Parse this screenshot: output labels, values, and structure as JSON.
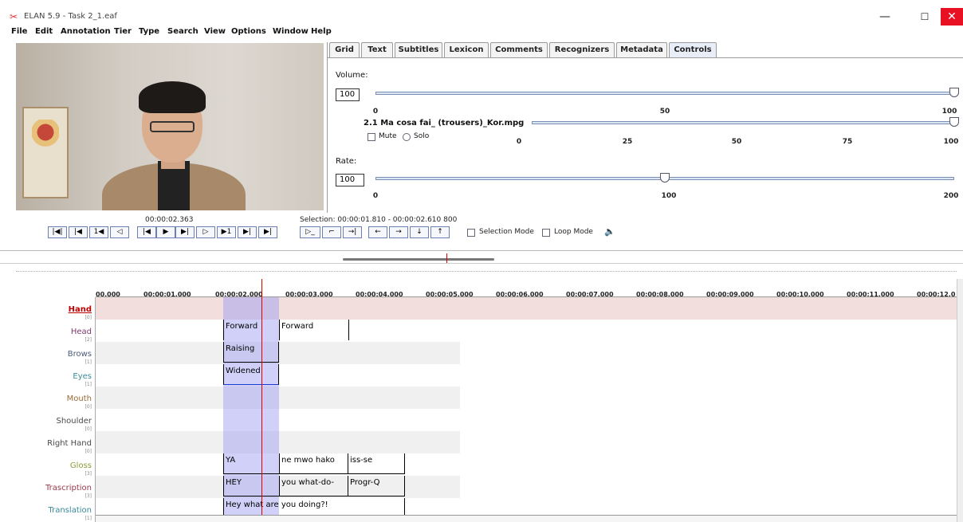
{
  "window": {
    "title": "ELAN 5.9 - Task 2_1.eaf",
    "logo": "elan-logo",
    "min": "—",
    "max": "☐",
    "close": "✕"
  },
  "menu": [
    "File",
    "Edit",
    "Annotation",
    "Tier",
    "Type",
    "Search",
    "View",
    "Options",
    "Window",
    "Help"
  ],
  "tabs": [
    "Grid",
    "Text",
    "Subtitles",
    "Lexicon",
    "Comments",
    "Recognizers",
    "Metadata",
    "Controls"
  ],
  "active_tab": "Controls",
  "controls": {
    "volume_label": "Volume:",
    "volume_value": "100",
    "volume_level": 100,
    "volume_ticks": [
      "0",
      "50",
      "100"
    ],
    "media_file": "2.1 Ma cosa fai_ (trousers)_Kor.mpg",
    "media_level": 100,
    "mute_label": "Mute",
    "solo_label": "Solo",
    "media_ticks": [
      "0",
      "25",
      "50",
      "75",
      "100"
    ],
    "rate_label": "Rate:",
    "rate_value": "100",
    "rate_level": 100,
    "rate_ticks": [
      "0",
      "100",
      "200"
    ]
  },
  "player": {
    "timecode": "00:00:02.363",
    "selection": "Selection: 00:00:01.810 - 00:00:02.610  800",
    "buttons": [
      "|◀|",
      "|◀",
      "1◀",
      "◁",
      "|◀",
      "▶",
      "▶|",
      "▷",
      "▶1",
      "▶|",
      "▶|"
    ],
    "sel_buttons": [
      "▷_",
      "⌐",
      "→|",
      "←",
      "→",
      "↓",
      "↑"
    ],
    "selection_mode_label": "Selection Mode",
    "loop_mode_label": "Loop Mode",
    "speaker_icon": "speaker-icon"
  },
  "ruler": [
    "00.000",
    "00:00:01.000",
    "00:00:02.000",
    "00:00:03.000",
    "00:00:04.000",
    "00:00:05.000",
    "00:00:06.000",
    "00:00:07.000",
    "00:00:08.000",
    "00:00:09.000",
    "00:00:10.000",
    "00:00:11.000",
    "00:00:12.0"
  ],
  "tiers": [
    {
      "name": "Hand",
      "count": "[0]",
      "color": "#c00000"
    },
    {
      "name": "Head",
      "count": "[2]",
      "color": "#7a3a6a"
    },
    {
      "name": "Brows",
      "count": "[1]",
      "color": "#4a5a7a"
    },
    {
      "name": "Eyes",
      "count": "[1]",
      "color": "#3a8a9a"
    },
    {
      "name": "Mouth",
      "count": "[0]",
      "color": "#9a6a3a"
    },
    {
      "name": "Shoulder",
      "count": "[0]",
      "color": "#4a4a4a"
    },
    {
      "name": "Right Hand",
      "count": "[0]",
      "color": "#4a4a4a"
    },
    {
      "name": "Gloss",
      "count": "[3]",
      "color": "#8a9a3a"
    },
    {
      "name": "Trascription",
      "count": "[3]",
      "color": "#9a3a4a"
    },
    {
      "name": "Translation",
      "count": "[1]",
      "color": "#3a8a9a"
    }
  ],
  "annotations": {
    "head": [
      "Forward",
      "Forward"
    ],
    "brows": [
      "Raising"
    ],
    "eyes": [
      "Widened"
    ],
    "gloss": [
      "YA",
      "ne mwo hako",
      "iss-se"
    ],
    "trascription": [
      "HEY",
      "you what-do-",
      "Progr-Q"
    ],
    "translation": [
      "Hey what are you doing?!"
    ]
  }
}
